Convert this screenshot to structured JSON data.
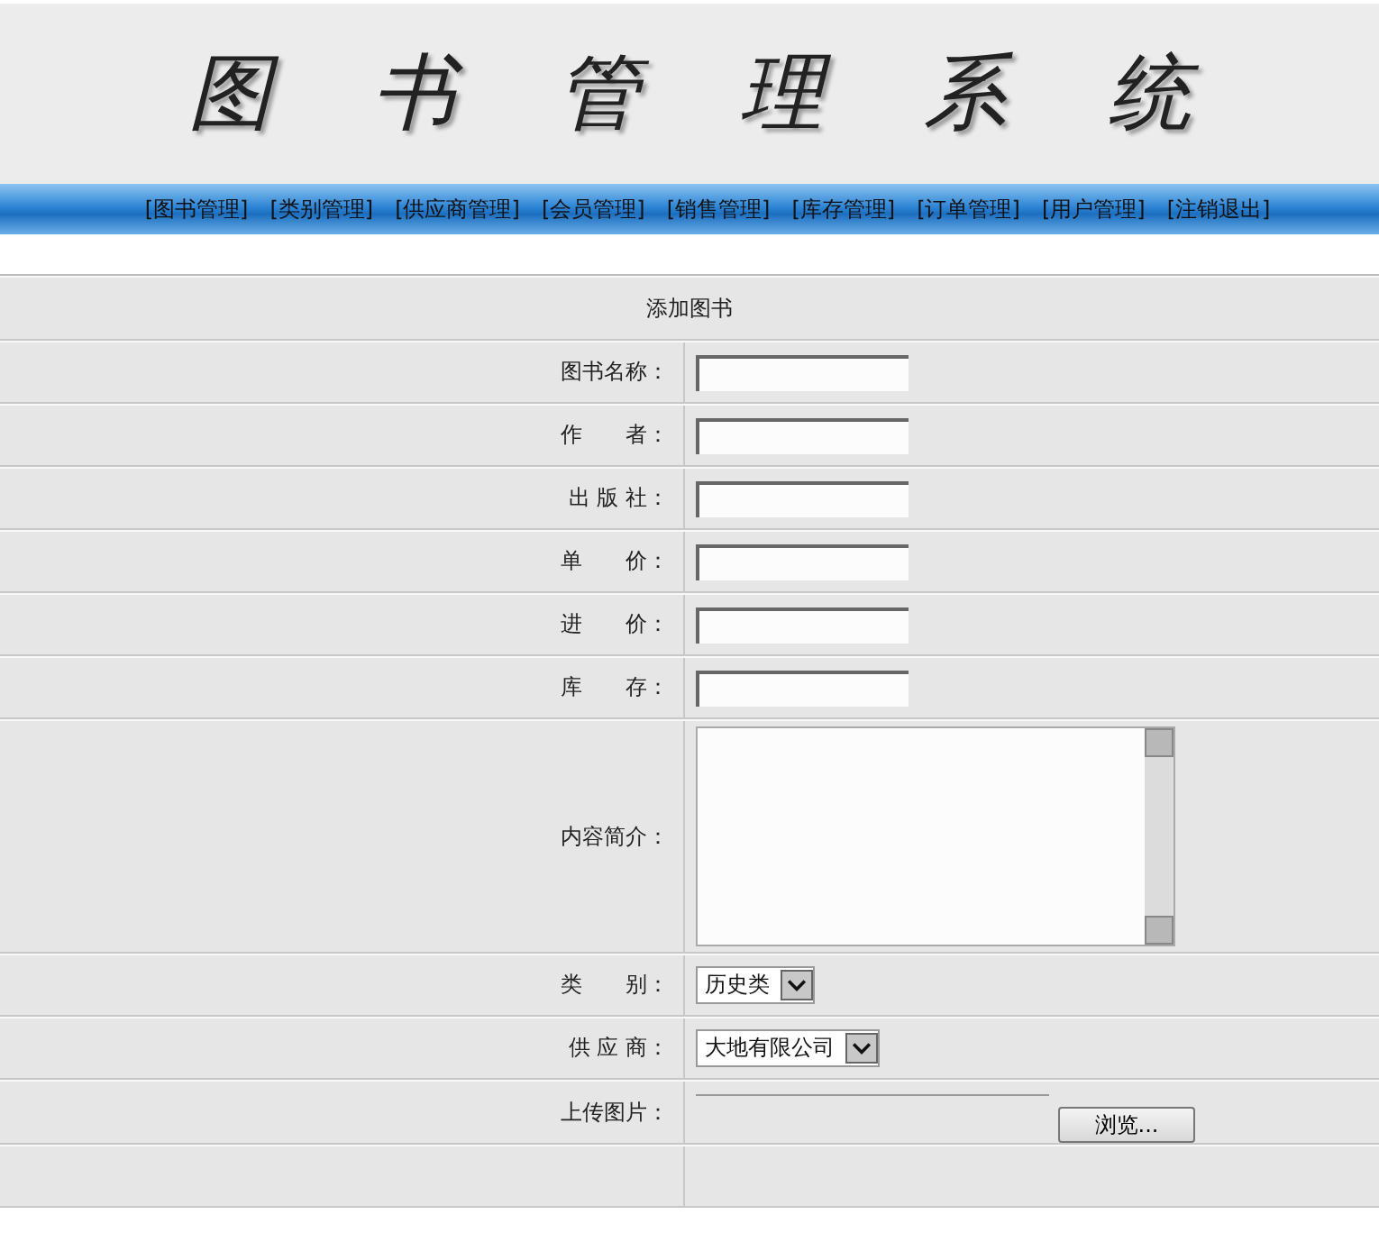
{
  "header": {
    "title": "图书管理系统"
  },
  "nav": [
    "[图书管理]",
    "[类别管理]",
    "[供应商管理]",
    "[会员管理]",
    "[销售管理]",
    "[库存管理]",
    "[订单管理]",
    "[用户管理]",
    "[注销退出]"
  ],
  "form": {
    "title": "添加图书",
    "rows": [
      {
        "label": "图书名称：",
        "kind": "text"
      },
      {
        "label": "作　　者：",
        "kind": "text"
      },
      {
        "label": "出 版 社：",
        "kind": "text"
      },
      {
        "label": "单　　价：",
        "kind": "text"
      },
      {
        "label": "进　　价：",
        "kind": "text"
      },
      {
        "label": "库　　存：",
        "kind": "text"
      },
      {
        "label": "内容简介：",
        "kind": "textarea"
      },
      {
        "label": "类　　别：",
        "kind": "select",
        "value": "历史类"
      },
      {
        "label": "供 应 商：",
        "kind": "select",
        "value": "大地有限公司"
      },
      {
        "label": "上传图片：",
        "kind": "file",
        "button": "浏览..."
      }
    ]
  }
}
